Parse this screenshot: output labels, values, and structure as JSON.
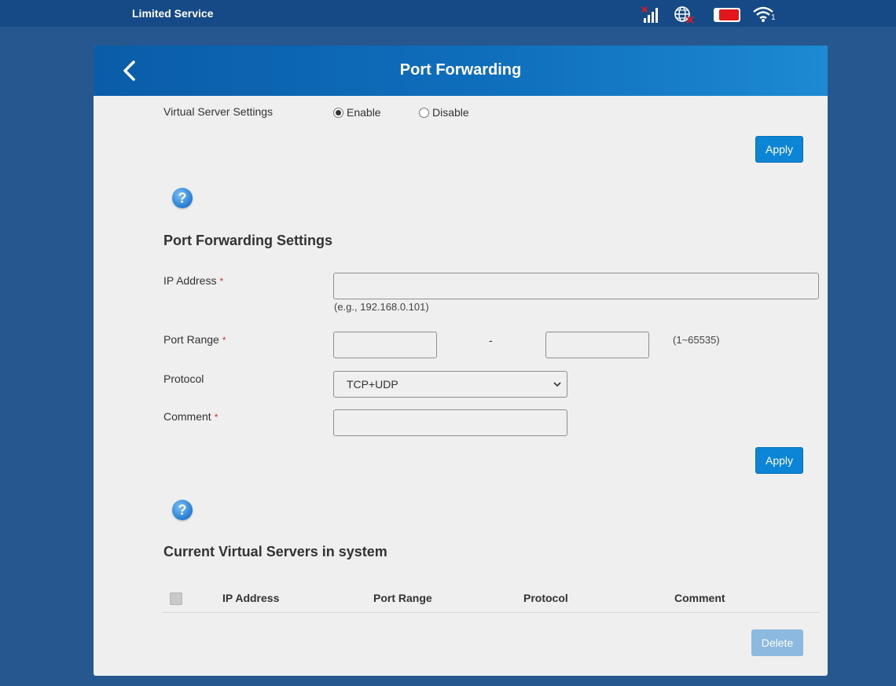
{
  "statusbar": {
    "service_text": "Limited Service",
    "icons": [
      "signal-icon",
      "globe-icon",
      "battery-icon",
      "wifi-icon"
    ],
    "wifi_count": "1"
  },
  "header": {
    "title": "Port Forwarding",
    "back_icon": "chevron-left-icon"
  },
  "virtual_server": {
    "label": "Virtual Server Settings",
    "options": [
      {
        "label": "Enable",
        "checked": true
      },
      {
        "label": "Disable",
        "checked": false
      }
    ],
    "apply_label": "Apply"
  },
  "help_icon": "?",
  "port_forwarding": {
    "title": "Port Forwarding Settings",
    "ip_label": "IP Address",
    "ip_value": "",
    "ip_hint": "(e.g., 192.168.0.101)",
    "port_label": "Port Range",
    "port_from": "",
    "port_to": "",
    "port_separator": "-",
    "port_hint": "(1~65535)",
    "protocol_label": "Protocol",
    "protocol_value": "TCP+UDP",
    "comment_label": "Comment",
    "comment_value": "",
    "required_mark": "*",
    "apply_label": "Apply"
  },
  "current_servers": {
    "title": "Current Virtual Servers in system",
    "columns": [
      "IP Address",
      "Port Range",
      "Protocol",
      "Comment"
    ],
    "rows": [],
    "delete_label": "Delete"
  },
  "colors": {
    "page_bg": "#27578f",
    "statusbar_bg": "#164a86",
    "header_gradient_start": "#0a5ca8",
    "header_gradient_end": "#1d8ad3",
    "button_blue": "#0c85d6",
    "button_disabled": "#8bb9df",
    "card_bg": "#efefef",
    "battery_red": "#e3161e"
  }
}
